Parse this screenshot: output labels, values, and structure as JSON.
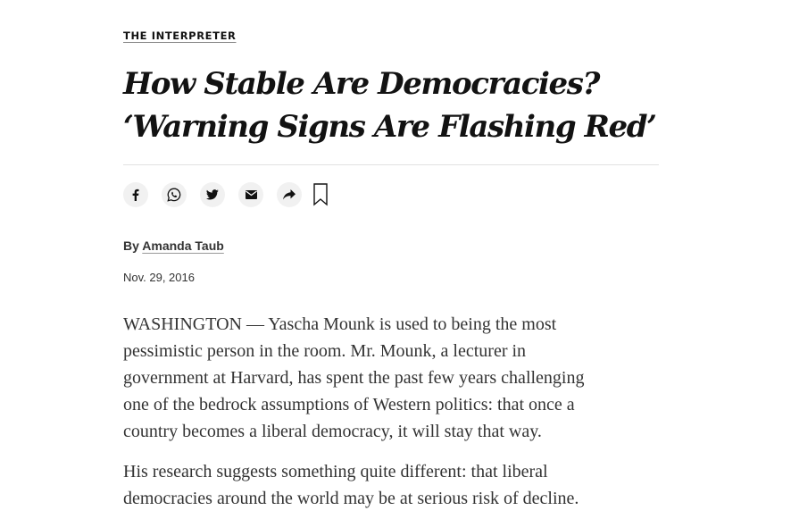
{
  "kicker": "THE INTERPRETER",
  "headline": {
    "line1": "How Stable Are Democracies?",
    "line2": "‘Warning Signs Are Flashing Red’"
  },
  "share_icons": [
    "facebook-icon",
    "whatsapp-icon",
    "twitter-icon",
    "email-icon",
    "share-icon",
    "bookmark-icon"
  ],
  "byline": {
    "prefix": "By",
    "author": "Amanda Taub"
  },
  "date": "Nov. 29, 2016",
  "paragraphs": [
    {
      "lines": [
        "WASHINGTON — Yascha Mounk is used to being the most",
        "pessimistic person in the room. Mr. Mounk, a lecturer in",
        "government at Harvard, has spent the past few years challenging",
        "one of the bedrock assumptions of Western politics: that once a",
        "country becomes a liberal democracy, it will stay that way."
      ]
    },
    {
      "lines": [
        "His research suggests something quite different: that liberal",
        "democracies around the world may be at serious risk of decline."
      ]
    }
  ],
  "colors": {
    "text_primary": "#121212",
    "text_body": "#333333",
    "rule": "#e2e2e2",
    "icon_bg": "#f1f1f1"
  }
}
